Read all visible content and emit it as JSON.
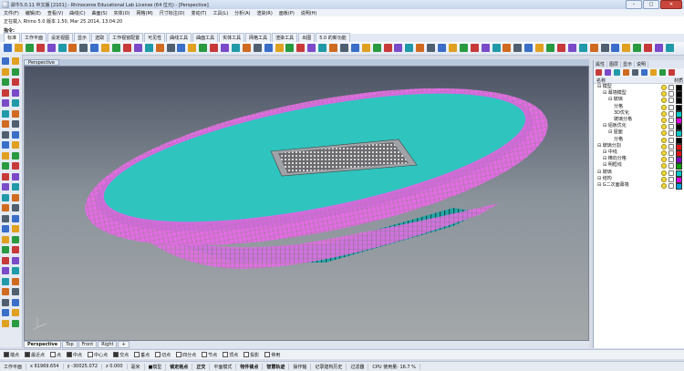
{
  "title": "犀牛5.0.11 中文版 [2101] - Rhinoceros Educational Lab License (64 位元) - [Perspective]",
  "menu": [
    "文件(F)",
    "编辑(E)",
    "查看(V)",
    "曲线(C)",
    "曲面(S)",
    "实体(O)",
    "网格(M)",
    "尺寸标注(D)",
    "变动(T)",
    "工具(L)",
    "分析(A)",
    "渲染(R)",
    "面板(P)",
    "说明(H)"
  ],
  "history_line": "正在载入 Rhino 5.0 版本 1.50, Mar 25 2014, 13:04:20",
  "command_label": "指令:",
  "toolbar_tabs": [
    "标准",
    "工作平面",
    "设定视图",
    "显示",
    "选取",
    "工作视窗配置",
    "可见性",
    "曲线工具",
    "曲面工具",
    "实体工具",
    "网格工具",
    "渲染工具",
    "出图",
    "5.0 的新功能"
  ],
  "viewport_title": "Perspective",
  "viewport_tabs": [
    "Perspective",
    "Top",
    "Front",
    "Right"
  ],
  "osnap": [
    {
      "label": "端点",
      "on": true
    },
    {
      "label": "最近点",
      "on": true
    },
    {
      "label": "点",
      "on": false
    },
    {
      "label": "中点",
      "on": true
    },
    {
      "label": "中心点",
      "on": false
    },
    {
      "label": "交点",
      "on": true
    },
    {
      "label": "垂点",
      "on": false
    },
    {
      "label": "切点",
      "on": false
    },
    {
      "label": "四分点",
      "on": false
    },
    {
      "label": "节点",
      "on": false
    },
    {
      "label": "顶点",
      "on": false
    },
    {
      "label": "投影",
      "on": false
    },
    {
      "label": "停用",
      "on": false
    }
  ],
  "status": [
    "工作平面",
    "x 61969.654",
    "y -30025.072",
    "z 0.000",
    "毫米",
    "■模型",
    "锁定格点",
    "正交",
    "平面模式",
    "物件锁点",
    "智慧轨迹",
    "操作轴",
    "记录建构历史",
    "过滤器",
    "CPU 使用量: 16.7 %"
  ],
  "right_panel": {
    "tabs": [
      "属性",
      "图层",
      "显示",
      "说明"
    ],
    "col_name": "名称",
    "col_material": "材质",
    "layers": [
      {
        "name": "模型",
        "indent": 0,
        "color": "#000000"
      },
      {
        "name": "幕墙模型",
        "indent": 1,
        "color": "#000000"
      },
      {
        "name": "玻璃",
        "indent": 2,
        "color": "#000000"
      },
      {
        "name": "分格",
        "indent": 3,
        "color": "#000000"
      },
      {
        "name": "3D优化",
        "indent": 3,
        "color": "#00c8c8"
      },
      {
        "name": "玻璃分格",
        "indent": 3,
        "color": "#e000e0"
      },
      {
        "name": "铝板优化",
        "indent": 1,
        "color": "#000000"
      },
      {
        "name": "屋面",
        "indent": 2,
        "color": "#00c8c8"
      },
      {
        "name": "分格",
        "indent": 3,
        "color": "#000000"
      },
      {
        "name": "玻璃分割",
        "indent": 0,
        "color": "#e01010"
      },
      {
        "name": "中线",
        "indent": 1,
        "color": "#e01010"
      },
      {
        "name": "横向分格",
        "indent": 1,
        "color": "#8000c0"
      },
      {
        "name": "明框线",
        "indent": 1,
        "color": "#00a000"
      },
      {
        "name": "玻璃",
        "indent": 0,
        "color": "#00c8c8"
      },
      {
        "name": "结构",
        "indent": 0,
        "color": "#e000e0"
      },
      {
        "name": "G二次面幕墙",
        "indent": 0,
        "color": "#00a0e0"
      }
    ]
  }
}
